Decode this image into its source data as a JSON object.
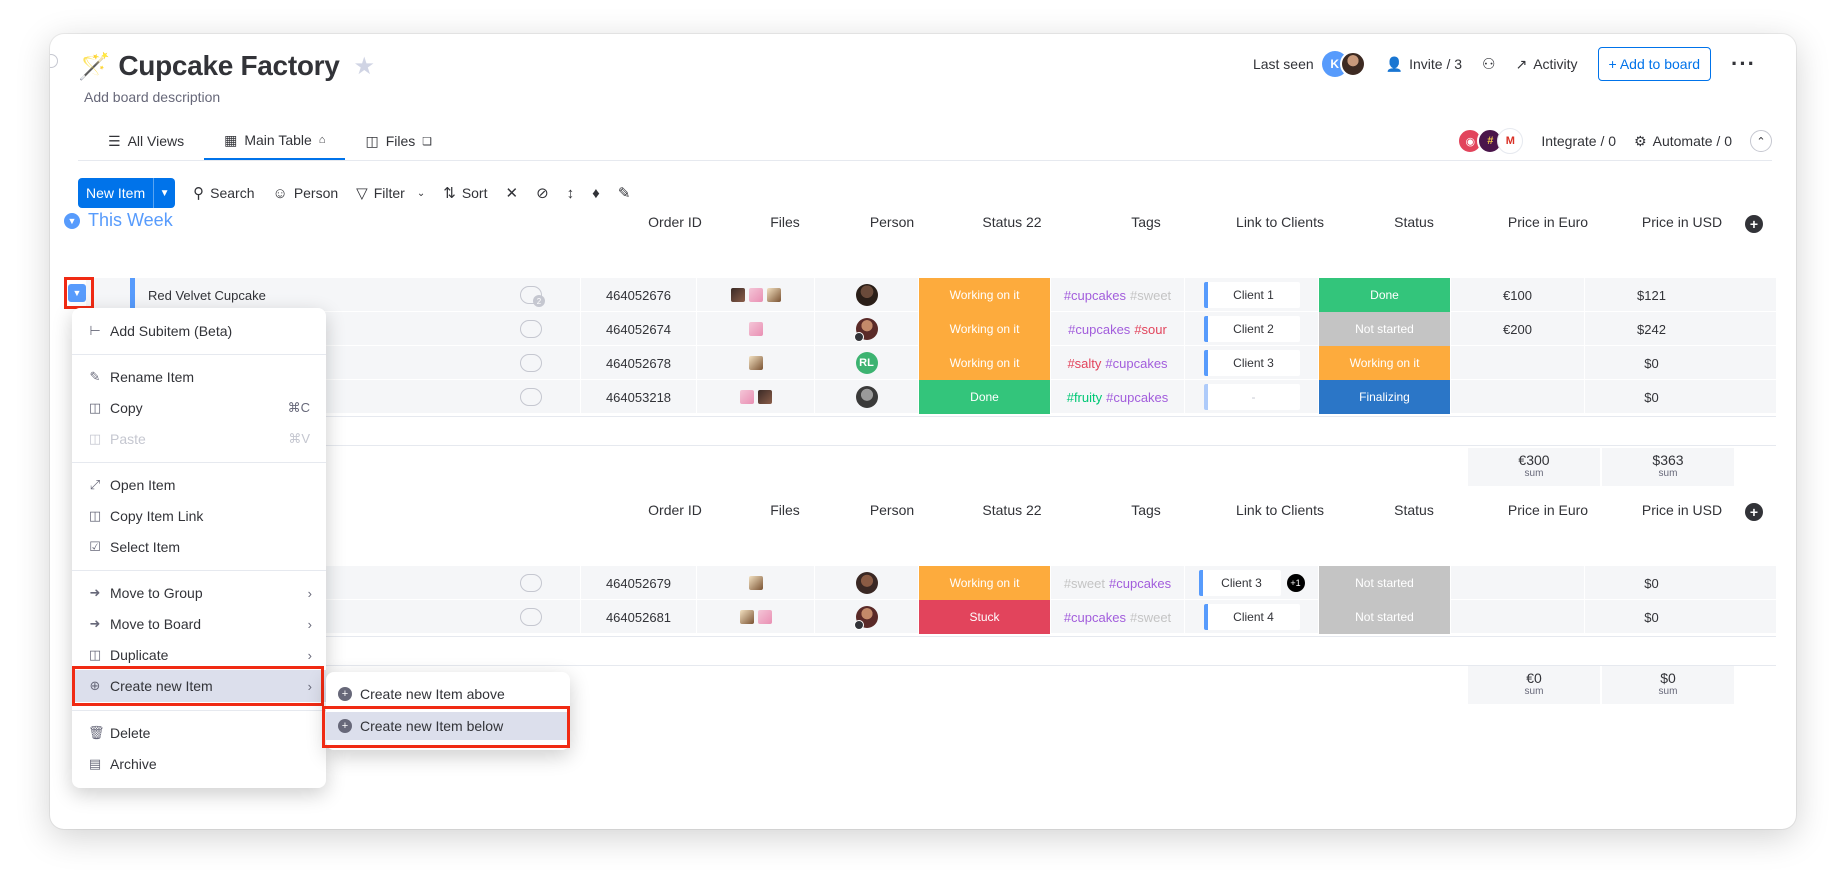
{
  "board": {
    "title": "Cupcake Factory",
    "description": "Add board description"
  },
  "header": {
    "last_seen": "Last seen",
    "avatar_initial": "K",
    "invite": "Invite / 3",
    "activity": "Activity",
    "add_to_board": "+ Add to board"
  },
  "tabs": [
    {
      "label": "All Views"
    },
    {
      "label": "Main Table"
    },
    {
      "label": "Files"
    }
  ],
  "integrations": {
    "integrate": "Integrate / 0",
    "automate": "Automate / 0"
  },
  "toolbar": {
    "new_item": "New Item",
    "search": "Search",
    "person": "Person",
    "filter": "Filter",
    "sort": "Sort"
  },
  "columns": [
    "Order ID",
    "Files",
    "Person",
    "Status 22",
    "Tags",
    "Link to Clients",
    "Status",
    "Price in Euro",
    "Price in USD"
  ],
  "group1": {
    "title": "This Week",
    "rows": [
      {
        "name": "Red Velvet Cupcake",
        "order_id": "464052676",
        "status22": "Working on it",
        "tags": [
          "#cupcakes",
          "#sweet"
        ],
        "client": "Client 1",
        "status": "Done",
        "euro": "€100",
        "usd": "$121"
      },
      {
        "name": "",
        "order_id": "464052674",
        "status22": "Working on it",
        "tags": [
          "#cupcakes",
          "#sour"
        ],
        "client": "Client 2",
        "status": "Not started",
        "euro": "€200",
        "usd": "$242"
      },
      {
        "name": "",
        "order_id": "464052678",
        "status22": "Working on it",
        "tags": [
          "#salty",
          "#cupcakes"
        ],
        "client": "Client 3",
        "status": "Working on it",
        "euro": "",
        "usd": "$0",
        "person_initials": "RL"
      },
      {
        "name": "",
        "order_id": "464053218",
        "status22": "Done",
        "tags": [
          "#fruity",
          "#cupcakes"
        ],
        "client": "-",
        "status": "Finalizing",
        "euro": "",
        "usd": "$0"
      }
    ],
    "sum_euro": "€300",
    "sum_usd": "$363",
    "sum_label": "sum"
  },
  "group2": {
    "rows": [
      {
        "order_id": "464052679",
        "status22": "Working on it",
        "tags": [
          "#sweet",
          "#cupcakes"
        ],
        "client": "Client 3",
        "client_extra": "+1",
        "status": "Not started",
        "euro": "",
        "usd": "$0"
      },
      {
        "order_id": "464052681",
        "status22": "Stuck",
        "tags": [
          "#cupcakes",
          "#sweet"
        ],
        "client": "Client 4",
        "status": "Not started",
        "euro": "",
        "usd": "$0"
      }
    ],
    "sum_euro": "€0",
    "sum_usd": "$0",
    "sum_label": "sum"
  },
  "menu": {
    "items": [
      {
        "label": "Add Subitem (Beta)"
      },
      {
        "label": "Rename Item"
      },
      {
        "label": "Copy",
        "shortcut": "⌘C"
      },
      {
        "label": "Paste",
        "shortcut": "⌘V"
      },
      {
        "label": "Open Item"
      },
      {
        "label": "Copy Item Link"
      },
      {
        "label": "Select Item"
      },
      {
        "label": "Move to Group"
      },
      {
        "label": "Move to Board"
      },
      {
        "label": "Duplicate"
      },
      {
        "label": "Create new Item"
      },
      {
        "label": "Delete"
      },
      {
        "label": "Archive"
      }
    ]
  },
  "submenu": {
    "items": [
      {
        "label": "Create new Item above"
      },
      {
        "label": "Create new Item below"
      }
    ]
  },
  "colors": {
    "accent": "#0073ea",
    "group": "#579bfc",
    "working": "#fdab3d",
    "done": "#33c57b",
    "not_started": "#c4c4c4",
    "stuck": "#e2445c",
    "finalizing": "#2b76c7",
    "highlight": "#f02a13"
  }
}
